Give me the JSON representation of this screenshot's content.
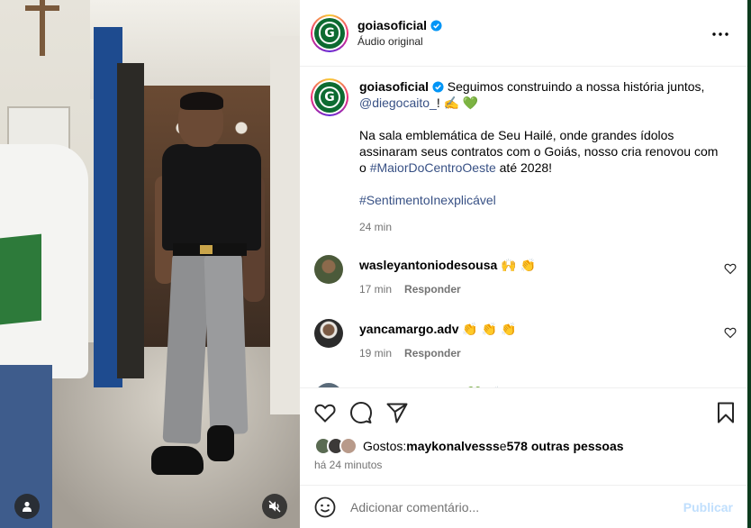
{
  "post": {
    "username": "goiasoficial",
    "audio_label": "Áudio original"
  },
  "caption": {
    "username": "goiasoficial",
    "line1": " Seguimos construindo a nossa história juntos,",
    "mention": "@diegocaito_",
    "after_mention": "! ✍️ 💚",
    "para2": "Na sala emblemática de Seu Hailé, onde grandes ídolos assinaram seus contratos com o Goiás, nosso cria renovou com o ",
    "hashtag1": "#MaiorDoCentroOeste",
    "para2_end": " até 2028!",
    "hashtag2": "#SentimentoInexplicável",
    "time": "24 min"
  },
  "comments": [
    {
      "user": "wasleyantoniodesousa",
      "text": " 🙌 👏",
      "time": "17 min",
      "reply": "Responder",
      "avatar_color": "#4b5a3a"
    },
    {
      "user": "yancamargo.adv",
      "text": " 👏 👏 👏",
      "time": "19 min",
      "reply": "Responder",
      "avatar_color": "#2b2b2b"
    },
    {
      "user": "lucasemanuelv11",
      "text": " 💚 👏",
      "time": "",
      "reply": "",
      "avatar_color": "#5a6b7a"
    }
  ],
  "likes": {
    "prefix": "Gostos: ",
    "first_user": "maykonalvesss",
    "conj": " e ",
    "others": "578 outras pessoas",
    "ago": "há 24 minutos"
  },
  "composer": {
    "placeholder": "Adicionar comentário...",
    "post_label": "Publicar"
  },
  "colors": {
    "link": "#385185",
    "club_green": "#0d6b31",
    "verified_blue": "#0095f6"
  }
}
